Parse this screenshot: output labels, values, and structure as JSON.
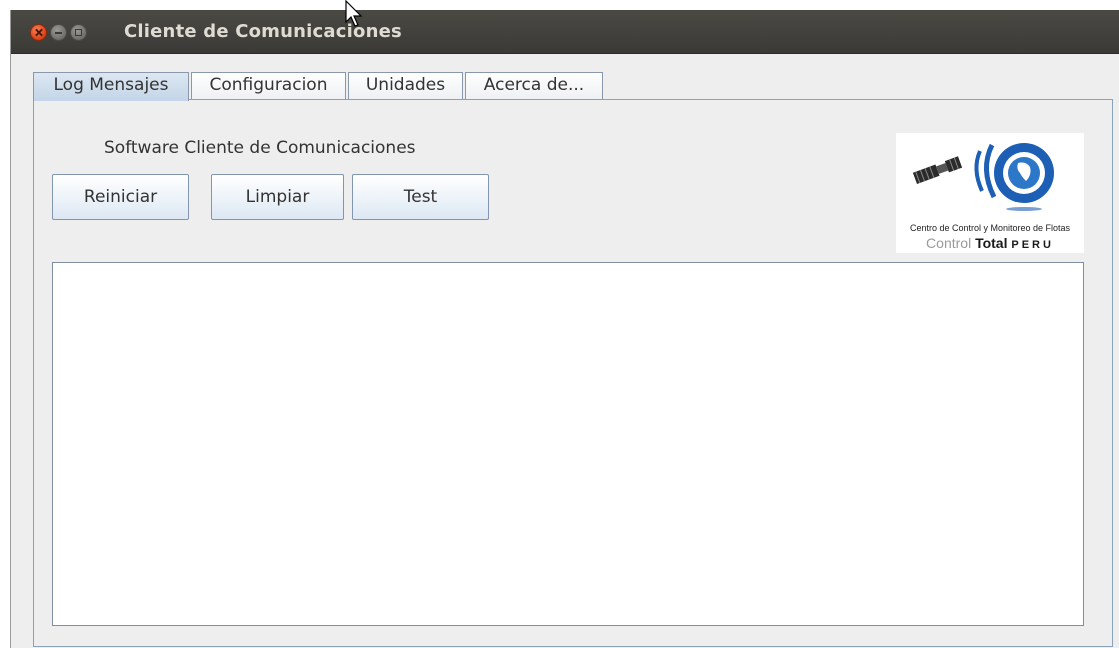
{
  "window": {
    "title": "Cliente de Comunicaciones"
  },
  "tabs": [
    {
      "label": "Log Mensajes",
      "active": true
    },
    {
      "label": "Configuracion",
      "active": false
    },
    {
      "label": "Unidades",
      "active": false
    },
    {
      "label": "Acerca de...",
      "active": false
    }
  ],
  "panel": {
    "subtitle": "Software Cliente de Comunicaciones",
    "buttons": {
      "reiniciar": "Reiniciar",
      "limpiar": "Limpiar",
      "test": "Test"
    },
    "log_text": ""
  },
  "logo": {
    "caption": "Centro de Control y Monitoreo de Flotas",
    "brand_control": "Control",
    "brand_total": "Total",
    "brand_peru": "PERU"
  },
  "colors": {
    "titlebar": "#3b3a36",
    "close_button": "#e0491f",
    "logo_blue": "#1c5fb4",
    "tab_active": "#c3d5e7"
  },
  "icons": {
    "close": "close-icon",
    "minimize": "minimize-icon",
    "maximize": "maximize-icon",
    "cursor": "mouse-cursor-icon",
    "logo": "satellite-logo-icon"
  }
}
